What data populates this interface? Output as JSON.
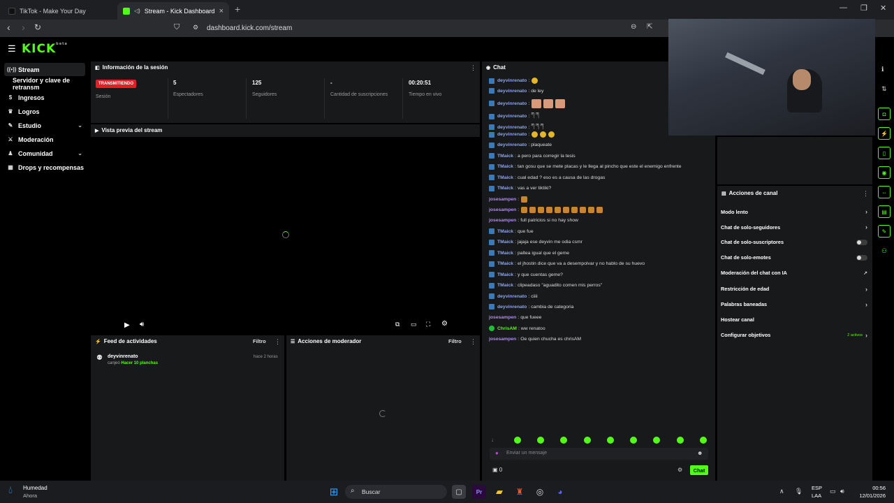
{
  "browser": {
    "tabs": [
      {
        "title": "TikTok - Make Your Day"
      },
      {
        "title": "Stream - Kick Dashboard"
      }
    ],
    "url": "dashboard.kick.com/stream"
  },
  "app": {
    "logo": "KICK",
    "logo_sup": "beta"
  },
  "sidebar": {
    "items": [
      {
        "label": "Stream",
        "icon": "broadcast-icon"
      },
      {
        "label": "Servidor y clave de retransm",
        "icon": ""
      },
      {
        "label": "Ingresos",
        "icon": "money-icon"
      },
      {
        "label": "Logros",
        "icon": "trophy-icon"
      },
      {
        "label": "Estudio",
        "icon": "brush-icon"
      },
      {
        "label": "Moderación",
        "icon": "sword-icon"
      },
      {
        "label": "Comunidad",
        "icon": "people-icon"
      },
      {
        "label": "Drops y recompensas",
        "icon": "gift-icon"
      }
    ]
  },
  "session": {
    "title": "Información de la sesión",
    "badge": "TRANSMITIENDO",
    "badge_label": "Sesión",
    "stats": [
      {
        "value": "5",
        "label": "Espectadores"
      },
      {
        "value": "125",
        "label": "Seguidores"
      },
      {
        "value": "-",
        "label": "Cantidad de suscripciones"
      },
      {
        "value": "00:20:51",
        "label": "Tiempo en vivo"
      }
    ]
  },
  "preview": {
    "title": "Vista previa del stream"
  },
  "activity": {
    "title": "Feed de actividades",
    "filter": "Filtro",
    "item": {
      "user": "deyvinrenato",
      "action": "canjeó",
      "reward": "Hacer 10 planchas",
      "time": "hace 2 horas"
    }
  },
  "moderator": {
    "title": "Acciones de moderador",
    "filter": "Filtro"
  },
  "chat": {
    "title": "Chat",
    "messages": [
      {
        "user": "deyvinrenato",
        "text": "",
        "badge": true,
        "kind": "d",
        "emotes": 1,
        "emote": "y"
      },
      {
        "user": "deyvinrenato",
        "text": "de ley",
        "badge": true,
        "kind": "d"
      },
      {
        "user": "deyvinrenato",
        "text": "",
        "badge": true,
        "kind": "d",
        "emotes": 3,
        "emote": "big"
      },
      {
        "user": "deyvinrenato",
        "text": "ཀ ཀ",
        "badge": true,
        "kind": "d"
      },
      {
        "user": "deyvinrenato",
        "text": "ཀ ཀ ཀ",
        "badge": true,
        "kind": "d"
      },
      {
        "user": "deyvinrenato",
        "text": "",
        "badge": true,
        "kind": "d",
        "emotes": 3,
        "emote": "y"
      },
      {
        "user": "deyvinrenato",
        "text": "plaqueate",
        "badge": true,
        "kind": "d"
      },
      {
        "user": "TMaick",
        "text": "a pero para corregir la tesis",
        "badge": true,
        "kind": "t"
      },
      {
        "user": "TMaick",
        "text": "tan gosu que se mete placas y le llega al pincho que este el enemigo enfrente",
        "badge": true,
        "kind": "t"
      },
      {
        "user": "TMaick",
        "text": "cual edad ? eso es a causa de las drogas",
        "badge": true,
        "kind": "t"
      },
      {
        "user": "TMaick",
        "text": "vas a ver tiktiki?",
        "badge": true,
        "kind": "t"
      },
      {
        "user": "josesampen",
        "text": "",
        "badge": false,
        "kind": "j",
        "emotes": 1,
        "emote": "e"
      },
      {
        "user": "josesampen",
        "text": "",
        "badge": false,
        "kind": "j",
        "emotes": 10,
        "emote": "e"
      },
      {
        "user": "josesampen",
        "text": "full patricios si no hay show",
        "badge": false,
        "kind": "j"
      },
      {
        "user": "TMaick",
        "text": "que fue",
        "badge": true,
        "kind": "t"
      },
      {
        "user": "TMaick",
        "text": "jajaja ese deyvin me odia csmr",
        "badge": true,
        "kind": "t"
      },
      {
        "user": "TMaick",
        "text": "paltea igual que el geme",
        "badge": true,
        "kind": "t"
      },
      {
        "user": "TMaick",
        "text": "el jhostin dice que va a desempolvar y no hablo de su huevo",
        "badge": true,
        "kind": "t"
      },
      {
        "user": "TMaick",
        "text": "y que cuentas geme?",
        "badge": true,
        "kind": "t"
      },
      {
        "user": "TMaick",
        "text": "clipeadaso \"aguadito comen mis perros\"",
        "badge": true,
        "kind": "t"
      },
      {
        "user": "deyvinrenato",
        "text": "ciiii",
        "badge": true,
        "kind": "d"
      },
      {
        "user": "deyvinrenato",
        "text": "cambia de categoria",
        "badge": true,
        "kind": "d"
      },
      {
        "user": "josesampen",
        "text": "que fueee",
        "badge": false,
        "kind": "j"
      },
      {
        "user": "ChrisAM",
        "text": "ww renatoo",
        "badge": false,
        "kind": "c"
      },
      {
        "user": "josesampen",
        "text": "Oe quien chucha es chrisAM",
        "badge": false,
        "kind": "j"
      }
    ],
    "input_placeholder": "Enviar un mensaje",
    "points": "0",
    "send_label": "Chat"
  },
  "channel": {
    "title": "Acciones de canal",
    "rows": [
      {
        "label": "Modo lento",
        "ctl": "chev"
      },
      {
        "label": "Chat de solo-seguidores",
        "ctl": "chev"
      },
      {
        "label": "Chat de solo-suscriptores",
        "ctl": "toggle"
      },
      {
        "label": "Chat de solo-emotes",
        "ctl": "toggle"
      },
      {
        "label": "Moderación del chat con IA",
        "ctl": "ext"
      },
      {
        "label": "Restricción de edad",
        "ctl": "chev"
      },
      {
        "label": "Palabras baneadas",
        "ctl": "chev"
      },
      {
        "label": "Hostear canal",
        "ctl": "none"
      },
      {
        "label": "Configurar objetivos",
        "ctl": "chev",
        "extra": "2 activos"
      }
    ]
  },
  "taskbar": {
    "weather_title": "Humedad",
    "weather_sub": "Ahora",
    "search": "Buscar",
    "lang": "ESP",
    "lang2": "LAA",
    "time": "00:56",
    "date": "12/01/2026"
  },
  "colors": {
    "accent": "#53fc18",
    "live": "#e21f26",
    "panel": "#18191b"
  }
}
